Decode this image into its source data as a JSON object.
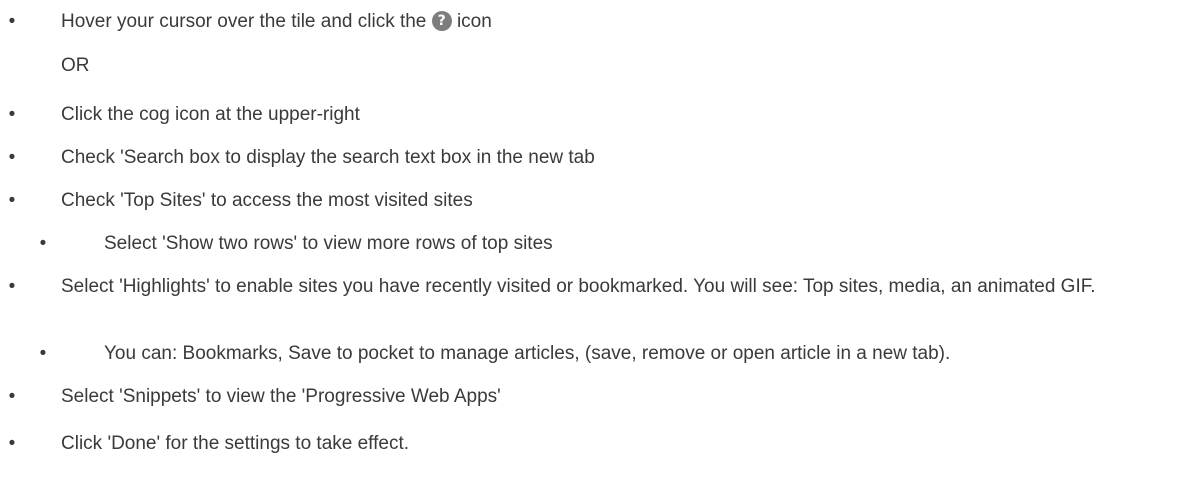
{
  "bullet_glyph": "•",
  "help_icon_glyph": "?",
  "items": [
    {
      "text_before": "Hover your cursor over the tile and click the",
      "text_after": "icon"
    },
    {
      "text": "OR"
    },
    {
      "text": "Click the cog icon at the upper-right"
    },
    {
      "text": "Check 'Search box to display the search text box in the new tab"
    },
    {
      "text": "Check 'Top Sites' to access the most visited sites"
    },
    {
      "text": "Select 'Show two rows' to view more rows of top sites"
    },
    {
      "text": "Select 'Highlights' to enable sites you have recently visited or bookmarked. You will see: Top sites, media, an animated GIF."
    },
    {
      "text": "You can: Bookmarks, Save to pocket to manage articles, (save, remove or open article in a new tab)."
    },
    {
      "text": "Select 'Snippets' to view the 'Progressive Web Apps'"
    },
    {
      "text": "Click 'Done' for the settings to take effect."
    }
  ]
}
